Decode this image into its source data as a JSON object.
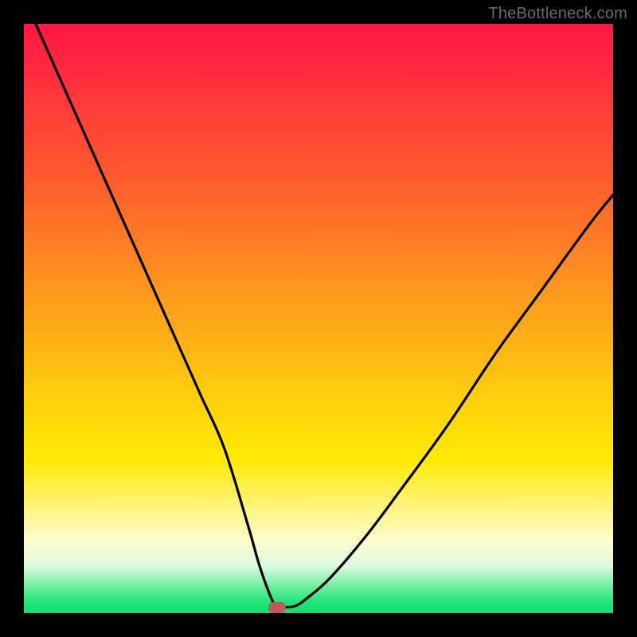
{
  "watermark": {
    "text": "TheBottleneck.com"
  },
  "chart_data": {
    "type": "line",
    "title": "",
    "xlabel": "",
    "ylabel": "",
    "xlim": [
      0,
      100
    ],
    "ylim": [
      0,
      100
    ],
    "grid": false,
    "legend": false,
    "series": [
      {
        "name": "bottleneck-curve",
        "x": [
          2,
          6,
          10,
          14,
          18,
          22,
          26,
          30,
          34,
          38,
          40,
          42,
          43,
          44,
          46,
          48,
          52,
          58,
          64,
          72,
          80,
          88,
          96,
          100
        ],
        "values": [
          100,
          91,
          82,
          73,
          64,
          55,
          46,
          37,
          28,
          15,
          8,
          2.5,
          1,
          1,
          1.2,
          2.5,
          6,
          13,
          21,
          32,
          44,
          55,
          66,
          71
        ]
      }
    ],
    "marker": {
      "x": 43,
      "y": 1
    },
    "background_gradient": {
      "stops": [
        {
          "pos": 0,
          "color": "#ff1744"
        },
        {
          "pos": 26,
          "color": "#ff5a2e"
        },
        {
          "pos": 56,
          "color": "#ffb814"
        },
        {
          "pos": 82,
          "color": "#fff380"
        },
        {
          "pos": 92,
          "color": "#dcfadf"
        },
        {
          "pos": 100,
          "color": "#12df6f"
        }
      ]
    }
  }
}
